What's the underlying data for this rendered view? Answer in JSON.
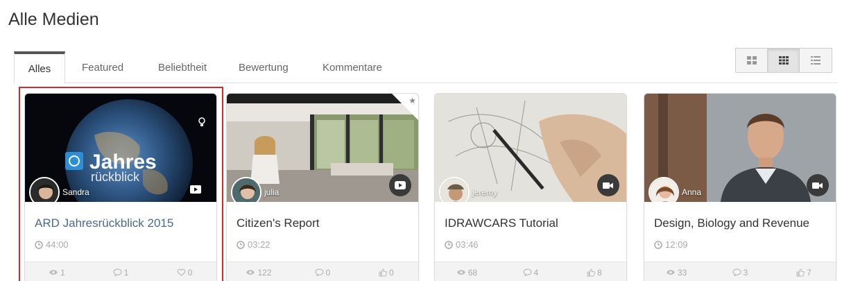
{
  "page": {
    "title": "Alle Medien"
  },
  "tabs": [
    {
      "label": "Alles",
      "active": true
    },
    {
      "label": "Featured",
      "active": false
    },
    {
      "label": "Beliebtheit",
      "active": false
    },
    {
      "label": "Bewertung",
      "active": false
    },
    {
      "label": "Kommentare",
      "active": false
    }
  ],
  "view_toggle": [
    "grid-large-icon",
    "grid-small-icon",
    "list-icon"
  ],
  "cards": [
    {
      "owner": "Sandra",
      "title": "ARD Jahresrückblick 2015",
      "duration": "44:00",
      "stats": {
        "views": "1",
        "comments": "1",
        "likes": "0"
      },
      "like_icon": "heart-icon",
      "media_type": "video-play-icon",
      "thumb_text_main": "Jahres",
      "thumb_text_sub": "rückblick"
    },
    {
      "owner": "julia",
      "title": "Citizen's Report",
      "duration": "03:22",
      "stats": {
        "views": "122",
        "comments": "0",
        "likes": "0"
      },
      "like_icon": "thumbs-up-icon",
      "media_type": "video-play-icon",
      "featured": true
    },
    {
      "owner": "jeremy",
      "title": "IDRAWCARS Tutorial",
      "duration": "03:46",
      "stats": {
        "views": "68",
        "comments": "4",
        "likes": "8"
      },
      "like_icon": "thumbs-up-icon",
      "media_type": "video-camera-icon"
    },
    {
      "owner": "Anna",
      "title": "Design, Biology and Revenue",
      "duration": "12:09",
      "stats": {
        "views": "33",
        "comments": "3",
        "likes": "7"
      },
      "like_icon": "thumbs-up-icon",
      "media_type": "video-camera-icon"
    }
  ],
  "colors": {
    "selection": "#d9252b",
    "link_title": "#4d6a8c"
  }
}
